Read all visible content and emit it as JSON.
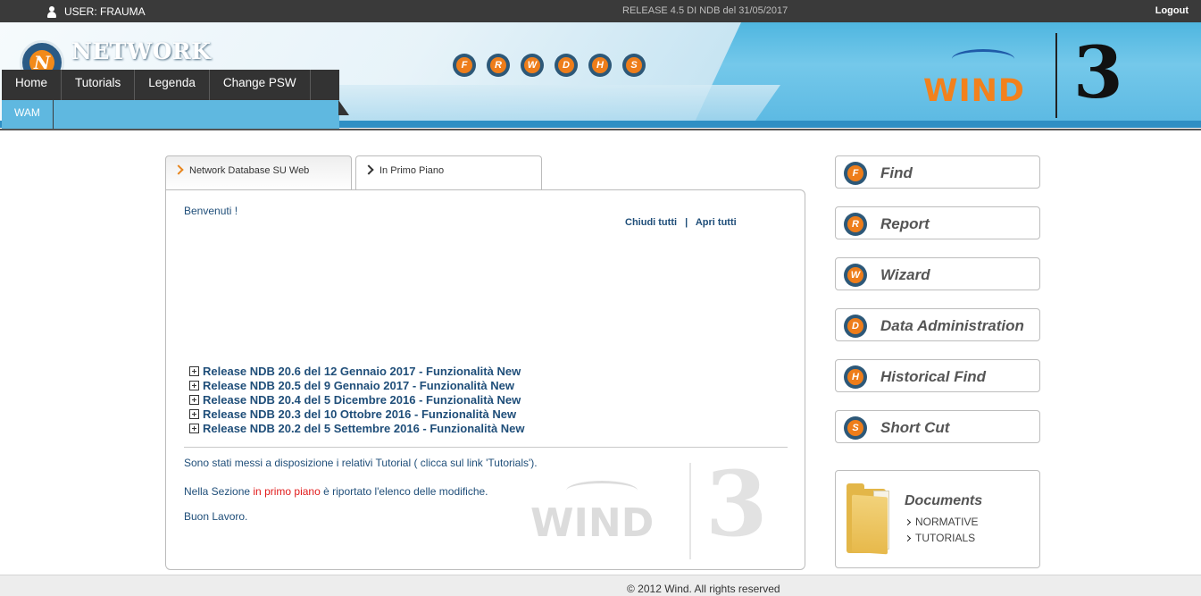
{
  "topbar": {
    "user_label": "USER: FRAUMA",
    "release": "RELEASE 4.5 DI NDB del 31/05/2017",
    "logout": "Logout"
  },
  "header": {
    "brand_letter": "N",
    "brand_name": "NETWORK",
    "letter_icons": [
      "F",
      "R",
      "W",
      "D",
      "H",
      "S"
    ],
    "partner_logo_wind": "WIND",
    "partner_logo_three": "3"
  },
  "nav": {
    "items": [
      "Home",
      "Tutorials",
      "Legenda",
      "Change PSW"
    ],
    "sub_items": [
      "WAM"
    ]
  },
  "tabs": [
    {
      "label": "Network Database SU Web",
      "active": true
    },
    {
      "label": "In Primo Piano",
      "active": false
    }
  ],
  "content": {
    "welcome": "Benvenuti !",
    "close_all": "Chiudi tutti",
    "separator": "|",
    "open_all": "Apri tutti",
    "releases": [
      "Release NDB 20.6 del 12 Gennaio 2017 - Funzionalità New",
      "Release NDB 20.5 del 9 Gennaio 2017 - Funzionalità New",
      "Release NDB 20.4 del 5 Dicembre 2016 - Funzionalità New",
      "Release NDB 20.3 del 10 Ottobre 2016 - Funzionalità New",
      "Release NDB 20.2 del 5 Settembre 2016 - Funzionalità New"
    ],
    "para1": "Sono stati messi a disposizione i relativi Tutorial ( clicca sul link 'Tutorials').",
    "para2_before": "Nella Sezione ",
    "para2_highlight": "in primo piano",
    "para2_after": " è riportato l'elenco delle modifiche.",
    "para3": "Buon Lavoro.",
    "watermark_wind": "WIND",
    "watermark_three": "3"
  },
  "side_menu": [
    {
      "letter": "F",
      "label": "Find"
    },
    {
      "letter": "R",
      "label": "Report"
    },
    {
      "letter": "W",
      "label": "Wizard"
    },
    {
      "letter": "D",
      "label": "Data Administration"
    },
    {
      "letter": "H",
      "label": "Historical Find"
    },
    {
      "letter": "S",
      "label": "Short Cut"
    }
  ],
  "documents": {
    "title": "Documents",
    "links": [
      "NORMATIVE",
      "TUTORIALS"
    ]
  },
  "footer": {
    "copyright": "© 2012 Wind. All rights reserved"
  },
  "colors": {
    "accent_orange": "#ee7d1a",
    "dark_blue": "#2d5878",
    "text_blue": "#1f4e79",
    "highlight_red": "#e11b1b",
    "header_blue": "#5ab8e2"
  },
  "icons": {
    "user": "user-icon",
    "folder": "folder-icon",
    "expand": "plus-box-icon",
    "chevron": "chevron-right-icon"
  }
}
